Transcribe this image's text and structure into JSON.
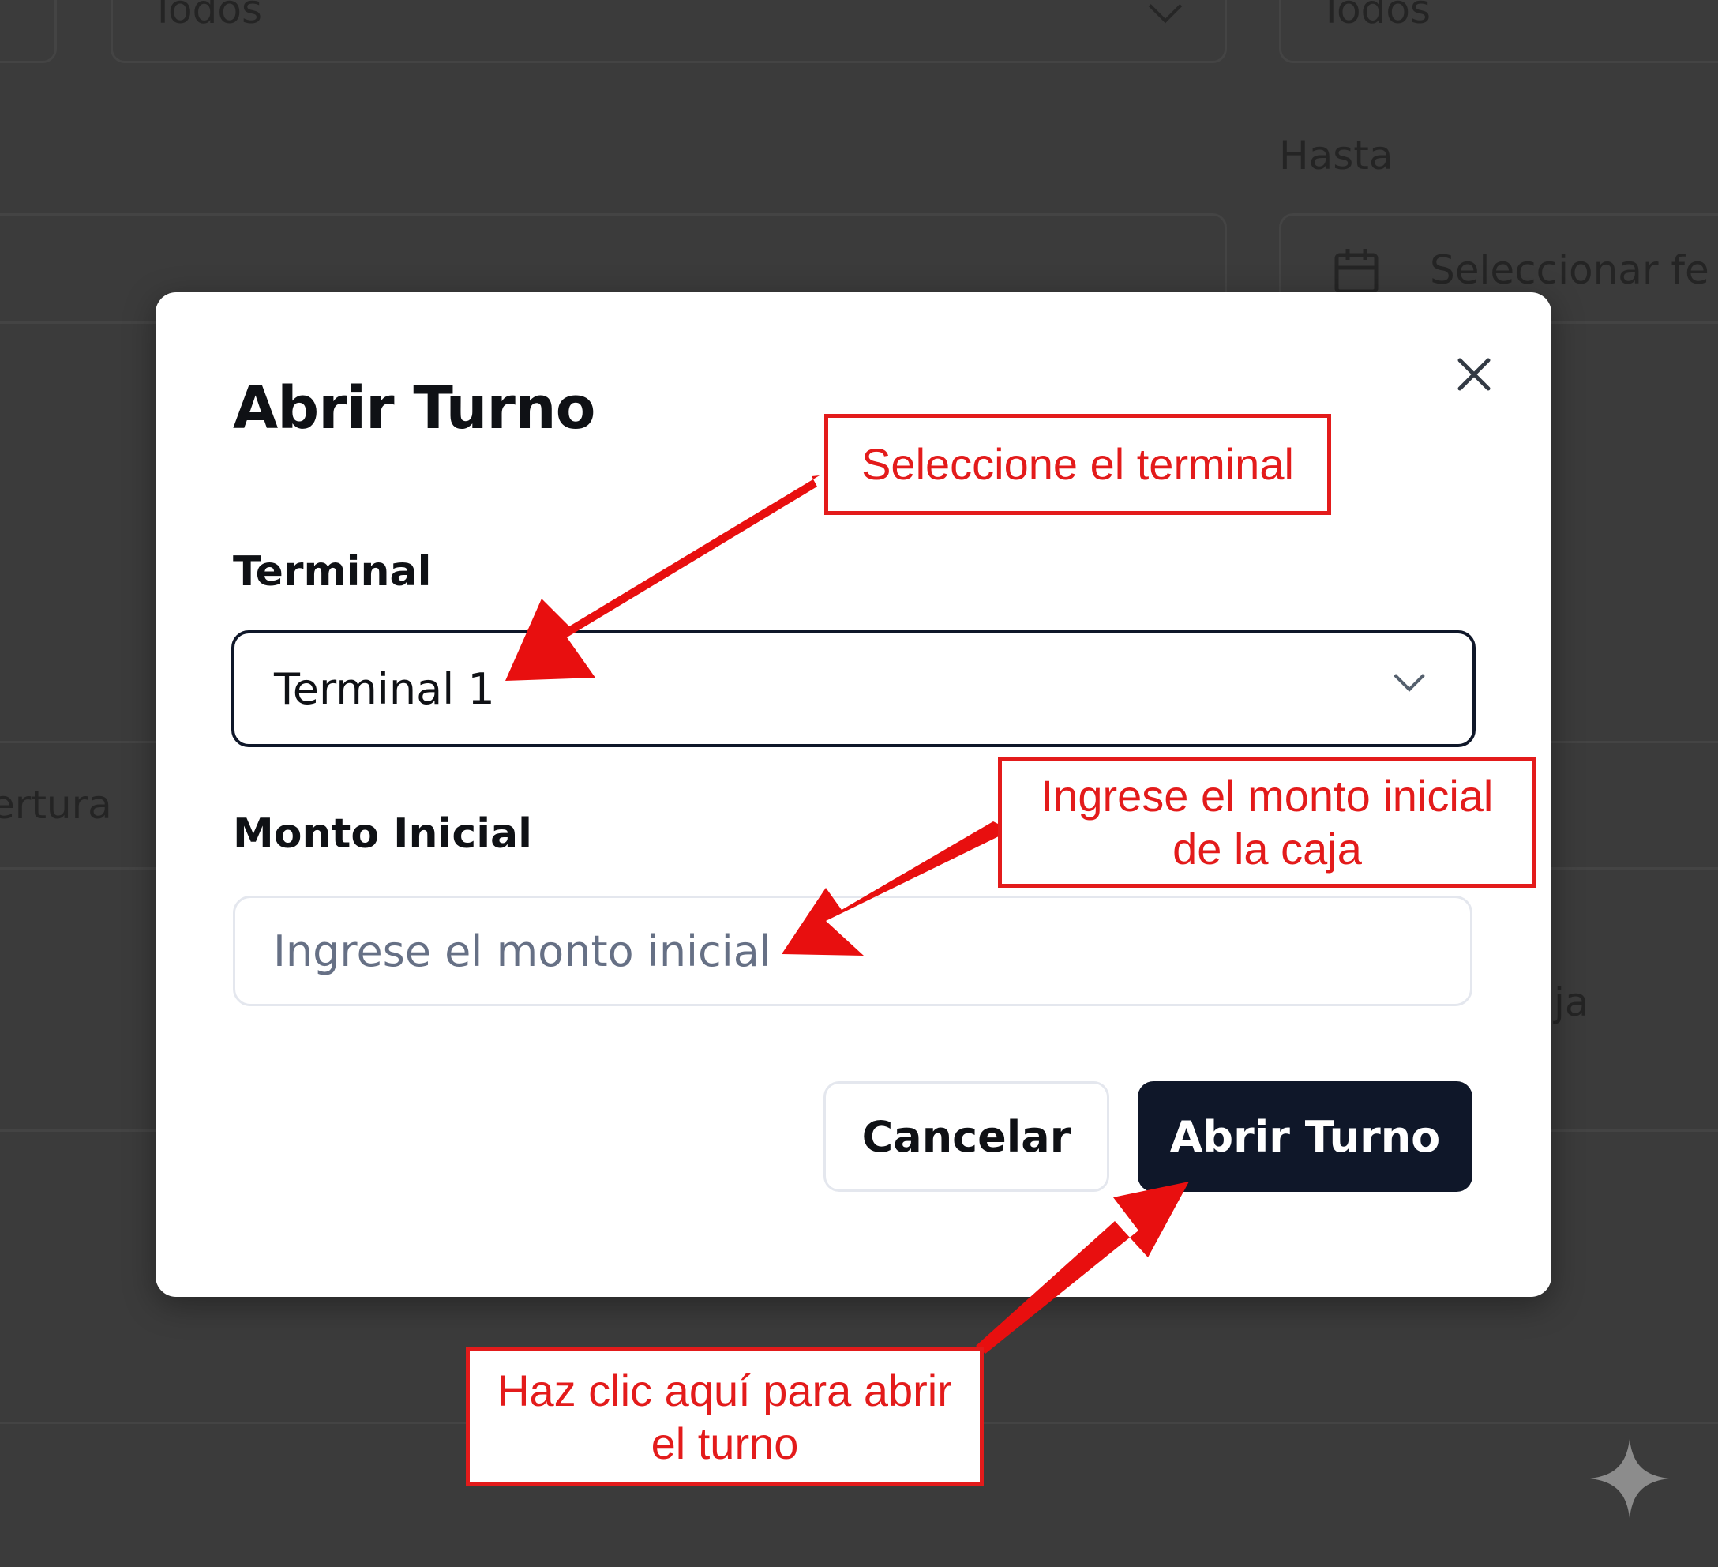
{
  "background": {
    "filter_left_value": "Todos",
    "filter_right_value": "Todos",
    "hasta_label": "Hasta",
    "date_placeholder": "Seleccionar fe",
    "partial_left_text": "ertura",
    "partial_right_text": "ja"
  },
  "modal": {
    "title": "Abrir Turno",
    "terminal_label": "Terminal",
    "terminal_selected": "Terminal 1",
    "amount_label": "Monto Inicial",
    "amount_placeholder": "Ingrese el monto inicial",
    "amount_value": "",
    "cancel_label": "Cancelar",
    "submit_label": "Abrir Turno"
  },
  "annotations": {
    "terminal_hint": "Seleccione el terminal",
    "amount_hint_line1": "Ingrese el monto inicial",
    "amount_hint_line2": "de la caja",
    "submit_hint_line1": "Haz clic aquí para abrir",
    "submit_hint_line2": "el turno"
  },
  "colors": {
    "annotation_red": "#e31b1b",
    "primary_button": "#0f1729",
    "overlay": "#3b3b3b"
  },
  "icons": [
    "close-icon",
    "chevron-down-icon",
    "calendar-icon",
    "sparkle-icon"
  ]
}
